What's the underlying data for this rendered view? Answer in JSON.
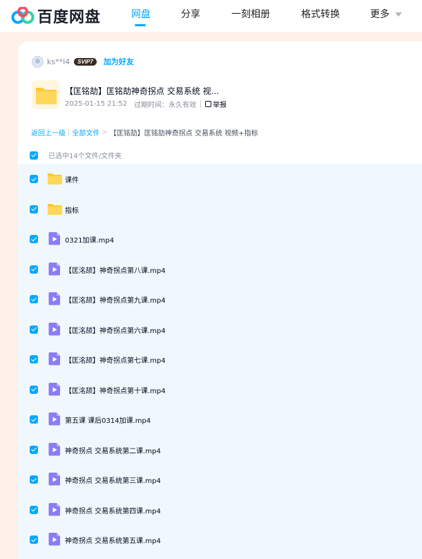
{
  "brand": {
    "name": "百度网盘",
    "accent": "#06a7ff"
  },
  "nav": {
    "items": [
      {
        "label": "网盘",
        "active": true
      },
      {
        "label": "分享",
        "active": false
      },
      {
        "label": "一刻相册",
        "active": false
      },
      {
        "label": "格式转换",
        "active": false
      },
      {
        "label": "更多",
        "active": false
      }
    ]
  },
  "sharer": {
    "username": "ks**l4",
    "badge": "SVIP7",
    "add_friend": "加为好友"
  },
  "share": {
    "title": "【匡铭劼】匡铭劼神奇拐点 交易系统 视...",
    "date": "2025-01-15 21:52",
    "expire_label": "过期时间：永久有效",
    "report": "举报"
  },
  "breadcrumb": {
    "back": "返回上一级",
    "all": "全部文件",
    "current": "【匡铭劼】匡铭劼神奇拐点 交易系统 视频+指标"
  },
  "selection": {
    "text": "已选中14个文件/文件夹"
  },
  "files": [
    {
      "name": "课件",
      "type": "folder-icon"
    },
    {
      "name": "指标",
      "type": "folder-icon"
    },
    {
      "name": "0321加课.mp4",
      "type": "video-icon"
    },
    {
      "name": "【匡洺颉】神奇拐点第八课.mp4",
      "type": "video-icon"
    },
    {
      "name": "【匡洺颉】神奇拐点第九课.mp4",
      "type": "video-icon"
    },
    {
      "name": "【匡洺颉】神奇拐点第六课.mp4",
      "type": "video-icon"
    },
    {
      "name": "【匡洺颉】神奇拐点第七课.mp4",
      "type": "video-icon"
    },
    {
      "name": "【匡洺颉】神奇拐点第十课.mp4",
      "type": "video-icon"
    },
    {
      "name": "第五课 课后0314加课.mp4",
      "type": "video-icon"
    },
    {
      "name": "神奇拐点 交易系统第二课.mp4",
      "type": "video-icon"
    },
    {
      "name": "神奇拐点 交易系统第三课.mp4",
      "type": "video-icon"
    },
    {
      "name": "神奇拐点 交易系统第四课.mp4",
      "type": "video-icon"
    },
    {
      "name": "神奇拐点 交易系统第五课.mp4",
      "type": "video-icon"
    }
  ]
}
